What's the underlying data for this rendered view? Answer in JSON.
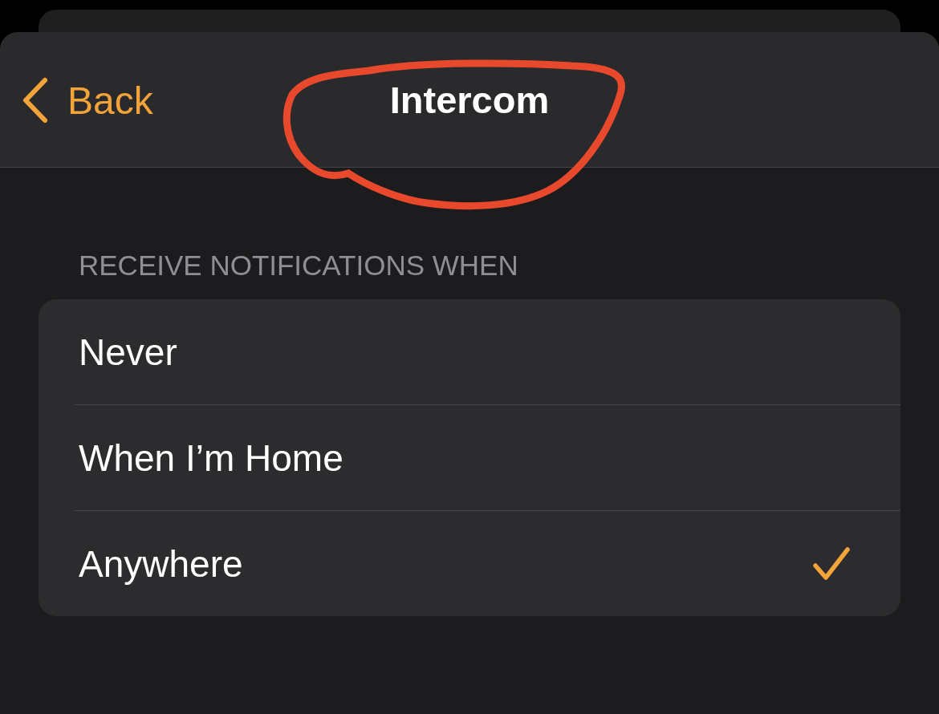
{
  "nav": {
    "back_label": "Back",
    "title": "Intercom"
  },
  "section": {
    "header": "RECEIVE NOTIFICATIONS WHEN",
    "options": [
      {
        "label": "Never",
        "selected": false
      },
      {
        "label": "When I’m Home",
        "selected": false
      },
      {
        "label": "Anywhere",
        "selected": true
      }
    ]
  }
}
